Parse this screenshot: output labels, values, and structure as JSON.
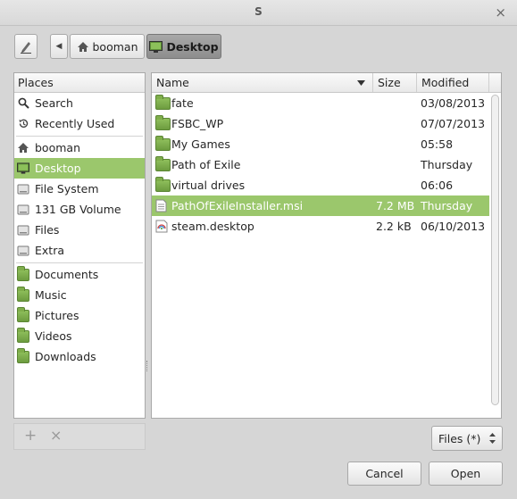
{
  "window": {
    "title": "S",
    "close_glyph": "×"
  },
  "toolbar": {
    "edit_icon": "pencil-icon",
    "back_glyph": "◀"
  },
  "path": [
    {
      "label": "booman",
      "icon": "home-icon",
      "active": false
    },
    {
      "label": "Desktop",
      "icon": "desktop-icon",
      "active": true
    }
  ],
  "places": {
    "header": "Places",
    "items": [
      {
        "label": "Search",
        "icon": "search-icon"
      },
      {
        "label": "Recently Used",
        "icon": "history-icon"
      },
      {
        "label": "booman",
        "icon": "home-icon"
      },
      {
        "label": "Desktop",
        "icon": "desktop-icon",
        "selected": true
      },
      {
        "label": "File System",
        "icon": "drive-icon"
      },
      {
        "label": "131 GB Volume",
        "icon": "drive-icon"
      },
      {
        "label": "Files",
        "icon": "drive-icon"
      },
      {
        "label": "Extra",
        "icon": "drive-icon"
      },
      {
        "label": "Documents",
        "icon": "folder-icon"
      },
      {
        "label": "Music",
        "icon": "folder-icon"
      },
      {
        "label": "Pictures",
        "icon": "folder-icon"
      },
      {
        "label": "Videos",
        "icon": "folder-icon"
      },
      {
        "label": "Downloads",
        "icon": "folder-icon"
      }
    ],
    "add_glyph": "+",
    "remove_glyph": "×"
  },
  "files": {
    "columns": {
      "name": "Name",
      "size": "Size",
      "modified": "Modified"
    },
    "rows": [
      {
        "name": "fate",
        "size": "",
        "modified": "03/08/2013",
        "icon": "folder-icon"
      },
      {
        "name": "FSBC_WP",
        "size": "",
        "modified": "07/07/2013",
        "icon": "folder-icon"
      },
      {
        "name": "My Games",
        "size": "",
        "modified": "05:58",
        "icon": "folder-icon"
      },
      {
        "name": "Path of Exile",
        "size": "",
        "modified": "Thursday",
        "icon": "folder-icon"
      },
      {
        "name": "virtual drives",
        "size": "",
        "modified": "06:06",
        "icon": "folder-icon"
      },
      {
        "name": "PathOfExileInstaller.msi",
        "size": "7.2 MB",
        "modified": "Thursday",
        "icon": "document-icon",
        "selected": true
      },
      {
        "name": "steam.desktop",
        "size": "2.2 kB",
        "modified": "06/10/2013",
        "icon": "desktop-file-icon"
      }
    ]
  },
  "filter": {
    "selected": "Files (*)"
  },
  "buttons": {
    "cancel": "Cancel",
    "open": "Open"
  },
  "colors": {
    "selection": "#9bc76c",
    "folder": "#7fae4b"
  }
}
